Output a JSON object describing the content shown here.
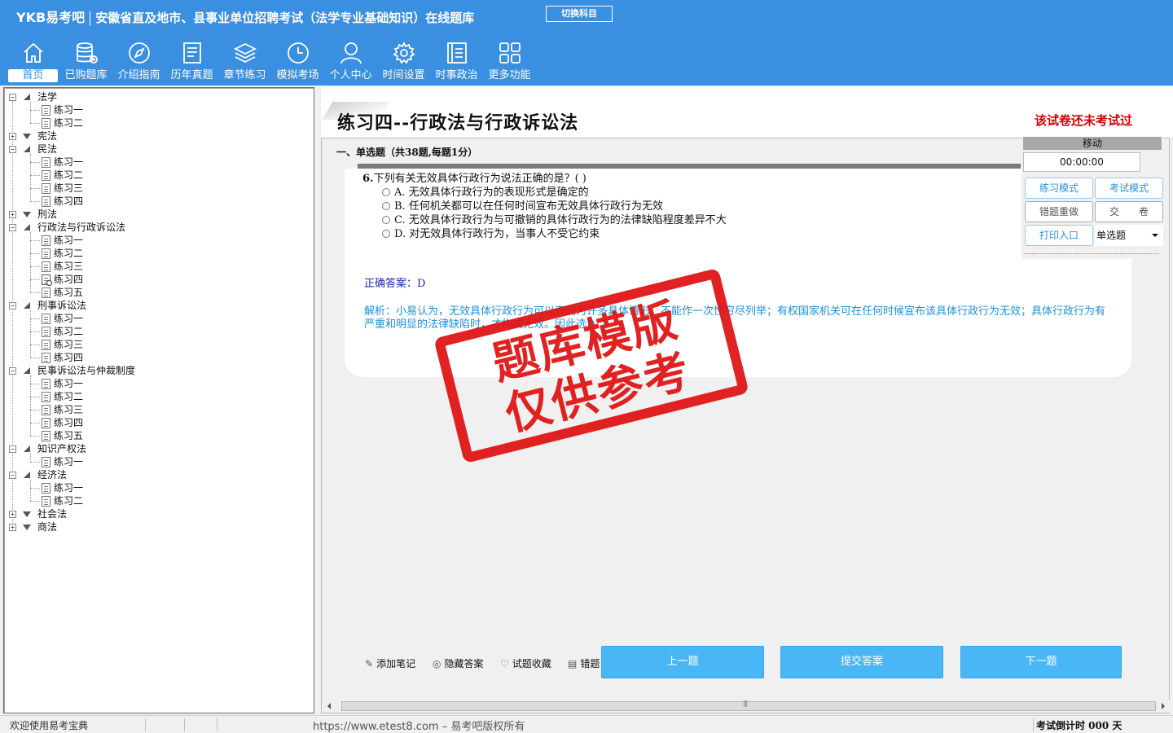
{
  "header": {
    "logo": "YKB易考吧",
    "title": "安徽省直及地市、县事业单位招聘考试（法学专业基础知识）在线题库",
    "switch_label": "切换科目"
  },
  "nav": [
    {
      "label": "首页",
      "icon": "home-icon"
    },
    {
      "label": "已购题库",
      "icon": "database-icon"
    },
    {
      "label": "介绍指南",
      "icon": "compass-icon"
    },
    {
      "label": "历年真题",
      "icon": "list-icon"
    },
    {
      "label": "章节练习",
      "icon": "layers-icon"
    },
    {
      "label": "模拟考场",
      "icon": "clock-icon"
    },
    {
      "label": "个人中心",
      "icon": "user-icon"
    },
    {
      "label": "时间设置",
      "icon": "gear-icon"
    },
    {
      "label": "时事政治",
      "icon": "document-icon"
    },
    {
      "label": "更多功能",
      "icon": "grid-icon"
    }
  ],
  "tree": [
    {
      "label": "法学",
      "open": true,
      "children": [
        "练习一",
        "练习二"
      ]
    },
    {
      "label": "宪法",
      "open": false,
      "children": []
    },
    {
      "label": "民法",
      "open": true,
      "children": [
        "练习一",
        "练习二",
        "练习三",
        "练习四"
      ]
    },
    {
      "label": "刑法",
      "open": false,
      "children": []
    },
    {
      "label": "行政法与行政诉讼法",
      "open": true,
      "children": [
        "练习一",
        "练习二",
        "练习三",
        "练习四",
        "练习五"
      ]
    },
    {
      "label": "刑事诉讼法",
      "open": true,
      "children": [
        "练习一",
        "练习二",
        "练习三",
        "练习四"
      ]
    },
    {
      "label": "民事诉讼法与仲裁制度",
      "open": true,
      "children": [
        "练习一",
        "练习二",
        "练习三",
        "练习四",
        "练习五"
      ]
    },
    {
      "label": "知识产权法",
      "open": true,
      "children": [
        "练习一"
      ]
    },
    {
      "label": "经济法",
      "open": true,
      "children": [
        "练习一",
        "练习二"
      ]
    },
    {
      "label": "社会法",
      "open": false,
      "children": []
    },
    {
      "label": "商法",
      "open": false,
      "children": []
    }
  ],
  "paper": {
    "title": "练习四--行政法与行政诉讼法",
    "status": "该试卷还未考试过",
    "section": "一、单选题（共38题,每题1分）"
  },
  "question": {
    "number": "6.",
    "text": "下列有关无效具体行政行为说法正确的是？( )",
    "options": [
      "A. 无效具体行政行为的表现形式是确定的",
      "B. 任何机关都可以在任何时间宣布无效具体行政行为无效",
      "C. 无效具体行政行为与可撤销的具体行政行为的法律缺陷程度差异不大",
      "D. 对无效具体行政行为，当事人不受它约束"
    ],
    "answer": "正确答案：D",
    "explanation": "解析：小易认为，无效具体行政行为可以表现为许多具体情形，不能作一次性穷尽列举；有权国家机关可在任何时候宣布该具体行政行为无效；具体行政行为有严重和明显的法律缺陷时，才构成无效。因此选D。"
  },
  "controls": {
    "move": "移动",
    "timer": "00:00:00",
    "practice_mode": "练习模式",
    "exam_mode": "考试模式",
    "redo_wrong": "错题重做",
    "submit_paper": "交　　卷",
    "print": "打印入口",
    "type_select": "单选题"
  },
  "tools": {
    "note": "添加笔记",
    "hide_answer": "隐藏答案",
    "favorite": "试题收藏",
    "wrong": "错题"
  },
  "buttons": {
    "prev": "上一题",
    "submit": "提交答案",
    "next": "下一题"
  },
  "status_bar": {
    "welcome": "欢迎使用易考宝典",
    "copyright": "https://www.etest8.com – 易考吧版权所有",
    "countdown": "考试倒计时 000 天"
  },
  "watermark": {
    "line1": "题库模版",
    "line2": "仅供参考"
  },
  "colors": {
    "header_bg": "#3a8fe0",
    "button_blue": "#49b6f5",
    "status_red": "#d40000",
    "explain_blue": "#1e90d8"
  }
}
